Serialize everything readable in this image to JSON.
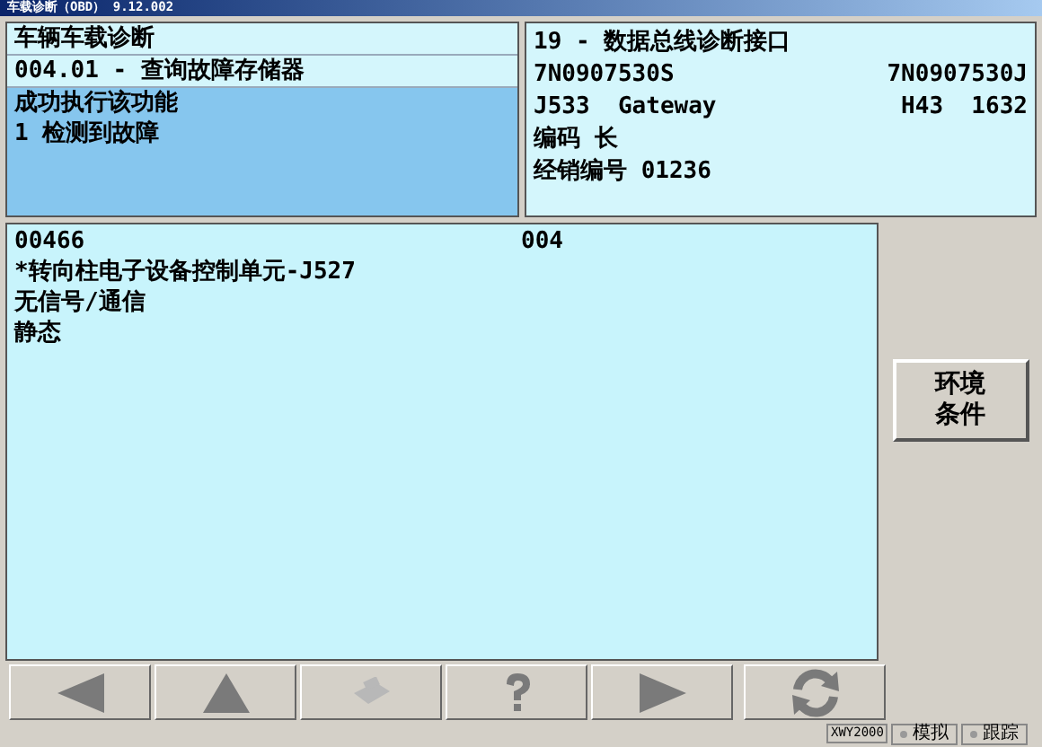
{
  "window": {
    "title": "车载诊断（OBD） 9.12.002"
  },
  "function_panel": {
    "lines": [
      {
        "text": "车辆车载诊断",
        "selected": false
      },
      {
        "text": "004.01 - 查询故障存储器",
        "selected": false
      }
    ],
    "result": [
      "成功执行该功能",
      "1 检测到故障"
    ]
  },
  "control_unit_panel": {
    "title": "19 - 数据总线诊断接口",
    "rows": [
      {
        "left": "7N0907530S",
        "right": "7N0907530J"
      },
      {
        "left": "J533  Gateway",
        "right": "H43  1632"
      },
      {
        "left": "编码 长"
      },
      {
        "left": "经销编号 01236"
      }
    ]
  },
  "fault_list": {
    "code": "00466",
    "column_2": "004",
    "lines": [
      "*转向柱电子设备控制单元-J527",
      "无信号/通信",
      "静态"
    ]
  },
  "side_button": {
    "label_lines": [
      "环境",
      "条件"
    ]
  },
  "toolbar": [
    {
      "kind": "back",
      "disabled": false
    },
    {
      "kind": "up",
      "disabled": false
    },
    {
      "kind": "print",
      "disabled": true
    },
    {
      "kind": "help",
      "disabled": false
    },
    {
      "kind": "forward",
      "disabled": false
    },
    {
      "kind": "refresh",
      "disabled": false
    }
  ],
  "status_bar": {
    "device": "XWY2000",
    "indicators": [
      "模拟",
      "跟踪"
    ]
  }
}
